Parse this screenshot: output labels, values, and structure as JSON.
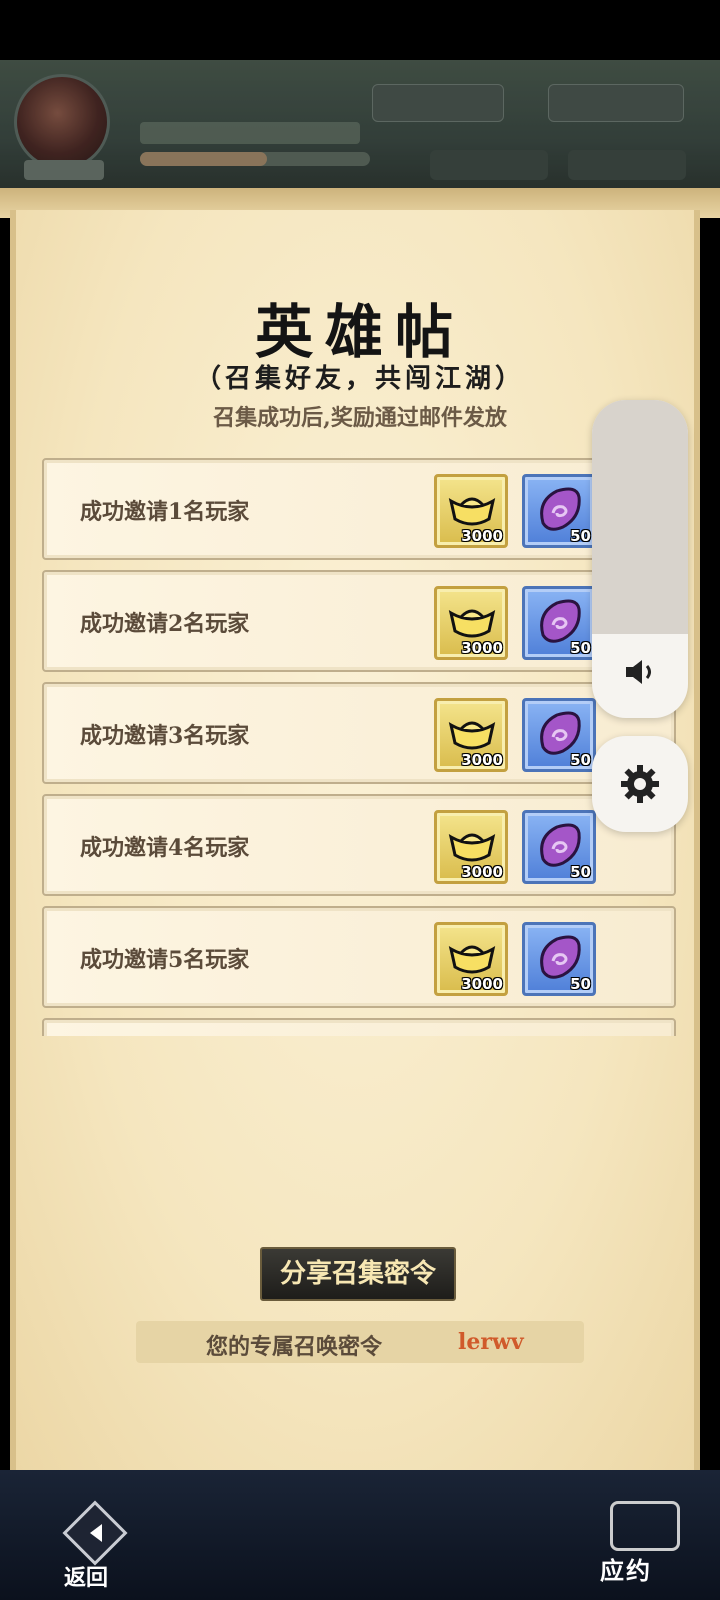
{
  "header": {
    "title": "英雄帖",
    "subtitle": "（召集好友，共闯江湖）",
    "note": "召集成功后,奖励通过邮件发放"
  },
  "rewards_list": [
    {
      "label": "成功邀请1名玩家",
      "gold_qty": "3000",
      "gem_qty": "50"
    },
    {
      "label": "成功邀请2名玩家",
      "gold_qty": "3000",
      "gem_qty": "50"
    },
    {
      "label": "成功邀请3名玩家",
      "gold_qty": "3000",
      "gem_qty": "50"
    },
    {
      "label": "成功邀请4名玩家",
      "gold_qty": "3000",
      "gem_qty": "50"
    },
    {
      "label": "成功邀请5名玩家",
      "gold_qty": "3000",
      "gem_qty": "50"
    }
  ],
  "share": {
    "button_label": "分享召集密令",
    "code_label": "您的专属召唤密令",
    "code_value": "lerwv"
  },
  "footer": {
    "back_label": "返回",
    "yueyue_label": "应约"
  },
  "icons": {
    "gold": "gold-ingot-icon",
    "gem": "purple-gem-icon",
    "volume": "volume-icon",
    "settings": "gear-icon",
    "back": "back-arrow-icon"
  },
  "colors": {
    "code_value": "#d05a2b",
    "scroll_paper": "#f5e6bf",
    "share_button_text": "#f7e7b3"
  }
}
